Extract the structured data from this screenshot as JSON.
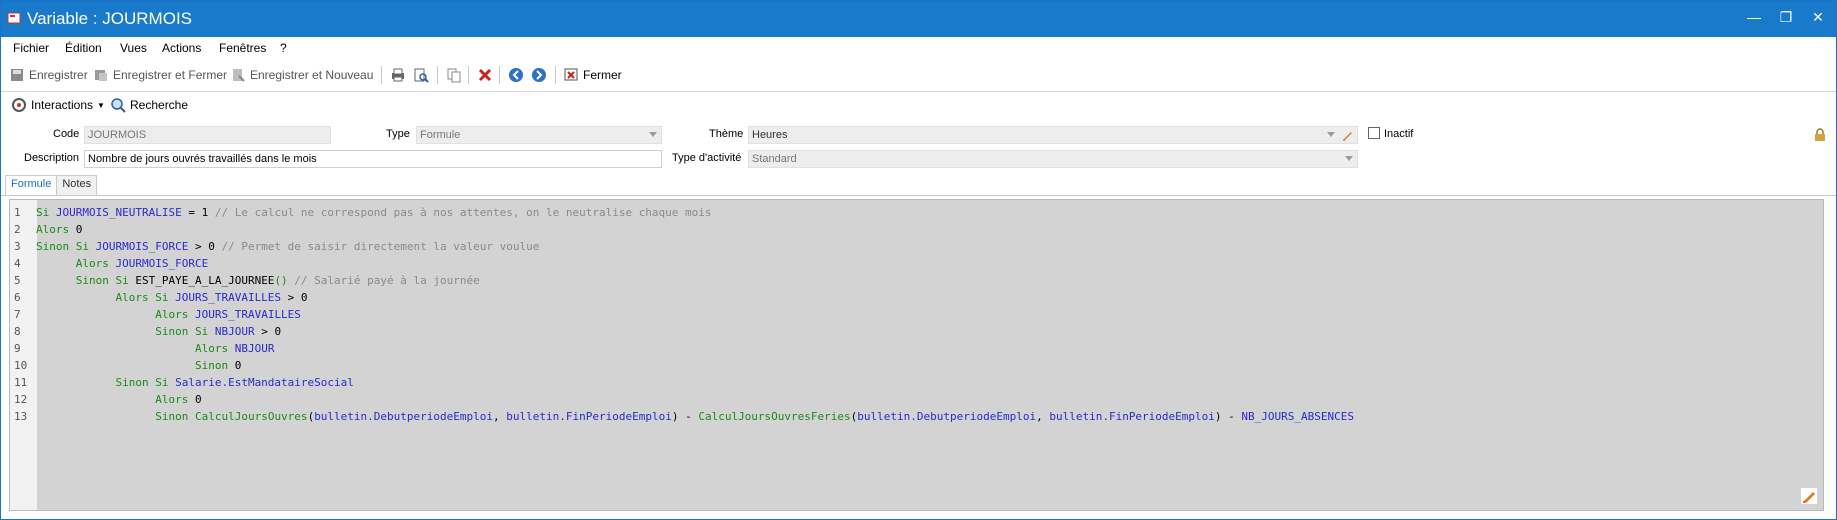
{
  "window": {
    "title": "Variable : JOURMOIS",
    "controls": [
      "—",
      "❐",
      "✕"
    ]
  },
  "menu": [
    "Fichier",
    "Édition",
    "Vues",
    "Actions",
    "Fenêtres",
    "?"
  ],
  "toolbar": {
    "save": "Enregistrer",
    "save_close": "Enregistrer et Fermer",
    "save_new": "Enregistrer et Nouveau",
    "close": "Fermer"
  },
  "toolbar2": {
    "interactions": "Interactions",
    "search": "Recherche"
  },
  "form": {
    "code_label": "Code",
    "code_value": "JOURMOIS",
    "type_label": "Type",
    "type_value": "Formule",
    "theme_label": "Thème",
    "theme_value": "Heures",
    "inactive_label": "Inactif",
    "description_label": "Description",
    "description_value": "Nombre de jours ouvrés travaillés dans le mois",
    "activity_label": "Type d'activité",
    "activity_value": "Standard"
  },
  "tabs": [
    "Formule",
    "Notes"
  ],
  "code_lines": [
    [
      [
        "kw",
        "Si "
      ],
      [
        "vr",
        "JOURMOIS_NEUTRALISE"
      ],
      [
        "tx",
        " = 1 "
      ],
      [
        "cm",
        "// Le calcul ne correspond pas à nos attentes, on le neutralise chaque mois"
      ]
    ],
    [
      [
        "kw",
        "Alors "
      ],
      [
        "tx",
        "0"
      ]
    ],
    [
      [
        "kw",
        "Sinon Si "
      ],
      [
        "vr",
        "JOURMOIS_FORCE"
      ],
      [
        "tx",
        " > 0 "
      ],
      [
        "cm",
        "// Permet de saisir directement la valeur voulue"
      ]
    ],
    [
      [
        "tx",
        "      "
      ],
      [
        "kw",
        "Alors "
      ],
      [
        "vr",
        "JOURMOIS_FORCE"
      ]
    ],
    [
      [
        "tx",
        "      "
      ],
      [
        "kw",
        "Sinon Si "
      ],
      [
        "tx",
        "EST_PAYE_A_LA_JOURNEE"
      ],
      [
        "kw",
        "()"
      ],
      [
        "cm",
        " // Salarié payé à la journée"
      ]
    ],
    [
      [
        "tx",
        "            "
      ],
      [
        "kw",
        "Alors Si "
      ],
      [
        "vr",
        "JOURS_TRAVAILLES"
      ],
      [
        "tx",
        " > 0"
      ]
    ],
    [
      [
        "tx",
        "                  "
      ],
      [
        "kw",
        "Alors "
      ],
      [
        "vr",
        "JOURS_TRAVAILLES"
      ]
    ],
    [
      [
        "tx",
        "                  "
      ],
      [
        "kw",
        "Sinon Si "
      ],
      [
        "vr",
        "NBJOUR"
      ],
      [
        "tx",
        " > 0"
      ]
    ],
    [
      [
        "tx",
        "                        "
      ],
      [
        "kw",
        "Alors "
      ],
      [
        "vr",
        "NBJOUR"
      ]
    ],
    [
      [
        "tx",
        "                        "
      ],
      [
        "kw",
        "Sinon "
      ],
      [
        "tx",
        "0"
      ]
    ],
    [
      [
        "tx",
        "            "
      ],
      [
        "kw",
        "Sinon Si "
      ],
      [
        "vr",
        "Salarie.EstMandataireSocial"
      ]
    ],
    [
      [
        "tx",
        "                  "
      ],
      [
        "kw",
        "Alors "
      ],
      [
        "tx",
        "0"
      ]
    ],
    [
      [
        "tx",
        "                  "
      ],
      [
        "kw",
        "Sinon "
      ],
      [
        "fn",
        "CalculJoursOuvres"
      ],
      [
        "tx",
        "("
      ],
      [
        "vr",
        "bulletin.DebutperiodeEmploi"
      ],
      [
        "tx",
        ", "
      ],
      [
        "vr",
        "bulletin.FinPeriodeEmploi"
      ],
      [
        "tx",
        ") - "
      ],
      [
        "fn",
        "CalculJoursOuvresFeries"
      ],
      [
        "tx",
        "("
      ],
      [
        "vr",
        "bulletin.DebutperiodeEmploi"
      ],
      [
        "tx",
        ", "
      ],
      [
        "vr",
        "bulletin.FinPeriodeEmploi"
      ],
      [
        "tx",
        ") - "
      ],
      [
        "vr",
        "NB_JOURS_ABSENCES"
      ]
    ]
  ]
}
